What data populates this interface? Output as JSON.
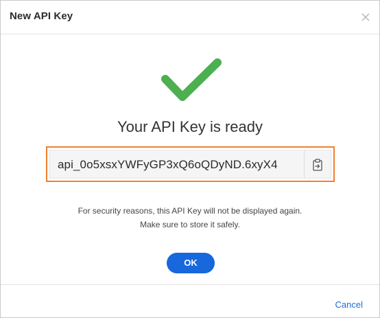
{
  "dialog": {
    "title": "New API Key",
    "heading": "Your API Key is ready",
    "api_key": "api_0o5xsxYWFyGP3xQ6oQDyND.6xyX4",
    "note_line1": "For security reasons, this API Key will not be displayed again.",
    "note_line2": "Make sure to store it safely.",
    "ok_label": "OK",
    "cancel_label": "Cancel"
  },
  "icons": {
    "close": "close-icon",
    "success": "checkmark-icon",
    "copy": "copy-clipboard-icon"
  },
  "colors": {
    "success_green": "#4caf50",
    "highlight_orange": "#f07f2e",
    "primary_blue": "#1668dc",
    "link_blue": "#1a6fd1"
  }
}
